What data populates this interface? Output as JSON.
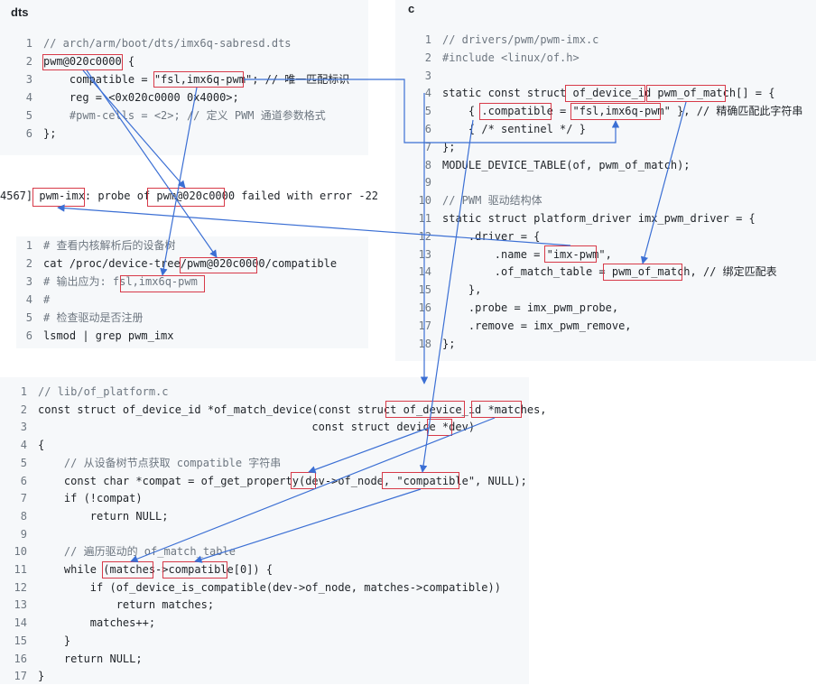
{
  "dts": {
    "header": "dts",
    "lines": [
      "// arch/arm/boot/dts/imx6q-sabresd.dts",
      "pwm@020c0000 {",
      "    compatible = \"fsl,imx6q-pwm\"; // 唯一匹配标识",
      "    reg = <0x020c0000 0x4000>;",
      "    #pwm-cells = <2>; // 定义 PWM 通道参数格式",
      "};"
    ]
  },
  "c": {
    "header": "c",
    "lines": [
      "// drivers/pwm/pwm-imx.c",
      "#include <linux/of.h>",
      "",
      "static const struct of_device_id pwm_of_match[] = {",
      "    { .compatible = \"fsl,imx6q-pwm\" }, // 精确匹配此字符串",
      "    { /* sentinel */ }",
      "};",
      "MODULE_DEVICE_TABLE(of, pwm_of_match);",
      "",
      "// PWM 驱动结构体",
      "static struct platform_driver imx_pwm_driver = {",
      "    .driver = {",
      "        .name = \"imx-pwm\",",
      "        .of_match_table = pwm_of_match, // 绑定匹配表",
      "    },",
      "    .probe = imx_pwm_probe,",
      "    .remove = imx_pwm_remove,",
      "};"
    ]
  },
  "error": {
    "text": "4567] pwm-imx: probe of pwm@020c0000 failed with error -22"
  },
  "shell": {
    "lines": [
      "# 查看内核解析后的设备树",
      "cat /proc/device-tree/pwm@020c0000/compatible",
      "# 输出应为: fsl,imx6q-pwm",
      "#",
      "# 检查驱动是否注册",
      "lsmod | grep pwm_imx"
    ]
  },
  "of_platform": {
    "lines": [
      "// lib/of_platform.c",
      "const struct of_device_id *of_match_device(const struct of_device_id *matches,",
      "                                          const struct device *dev)",
      "{",
      "    // 从设备树节点获取 compatible 字符串",
      "    const char *compat = of_get_property(dev->of_node, \"compatible\", NULL);",
      "    if (!compat)",
      "        return NULL;",
      "",
      "    // 遍历驱动的 of_match_table",
      "    while (matches->compatible[0]) {",
      "        if (of_device_is_compatible(dev->of_node, matches->compatible))",
      "            return matches;",
      "        matches++;",
      "    }",
      "    return NULL;",
      "}"
    ]
  }
}
